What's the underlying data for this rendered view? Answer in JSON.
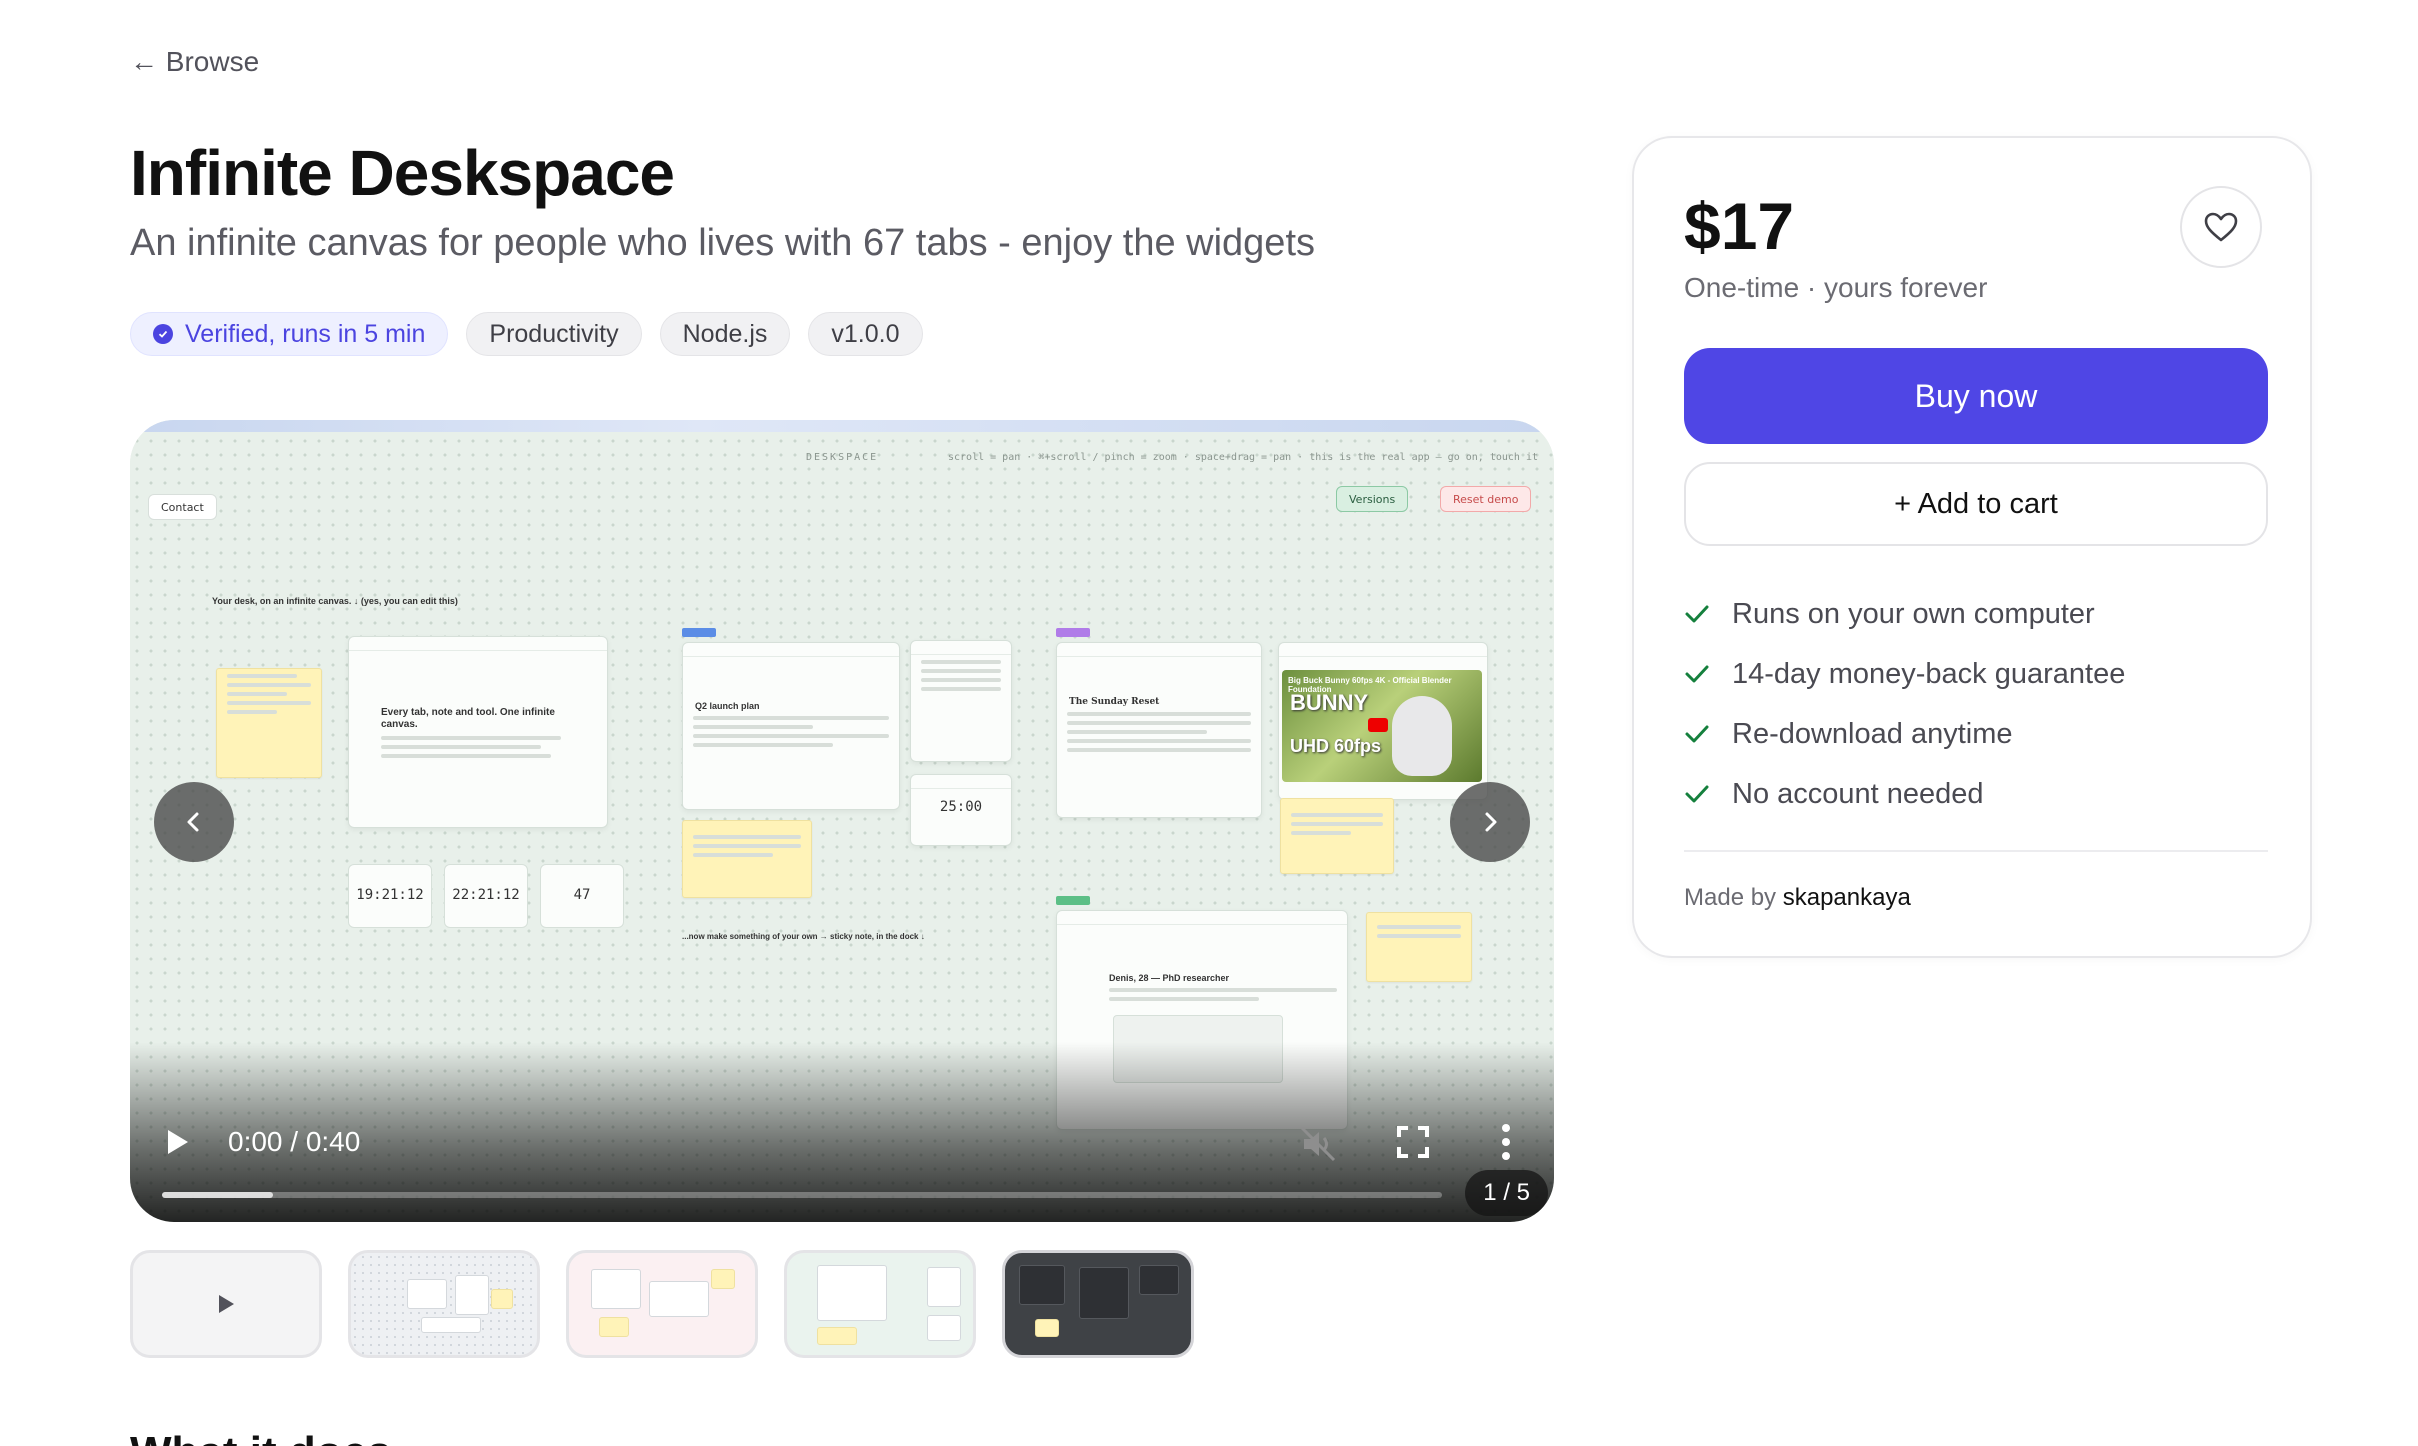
{
  "nav": {
    "back_label": "← Browse"
  },
  "product": {
    "title": "Infinite Deskspace",
    "subtitle": "An infinite canvas for people who lives with 67 tabs - enjoy the widgets",
    "tags": [
      {
        "label": "Verified, runs in 5 min",
        "icon": "verified-check-icon",
        "color": "#4b44e0"
      },
      {
        "label": "Productivity"
      },
      {
        "label": "Node.js"
      },
      {
        "label": "v1.0.0"
      }
    ]
  },
  "viewer": {
    "time": "0:00 / 0:40",
    "counter": "1 / 5",
    "progress_fraction": 0.087,
    "preview": {
      "brand": "DESKSPACE",
      "hint": "scroll = pan · ⌘+scroll / pinch = zoom · space+drag = pan · this is the real app — go on, touch it",
      "contact": "Contact",
      "versions": "Versions",
      "reset": "Reset demo",
      "intro": "Your desk, on an infinite canvas. ↓ (yes, you can edit this)",
      "card_heading": "Every tab, note and tool. One infinite canvas.",
      "q2": "Q2 launch plan",
      "sunday": "The Sunday Reset",
      "timer": "25:00",
      "clock1": "19:21:12",
      "clock2": "22:21:12",
      "count": "47",
      "cta": "...now make something of your own → sticky note, in the dock ↓",
      "profile": "Denis, 28 — PhD researcher",
      "video_title": "Big Buck Bunny 60fps 4K - Official Blender Foundation",
      "video_big": "BUNNY",
      "video_uhd": "UHD 60fps"
    }
  },
  "thumbnails": [
    "video",
    "canvas-light",
    "canvas-pink",
    "canvas-green",
    "canvas-dark"
  ],
  "section": {
    "heading": "What it does"
  },
  "purchase": {
    "price": "$17",
    "price_note": "One-time · yours forever",
    "buy_label": "Buy now",
    "cart_label": "+ Add to cart",
    "features": [
      "Runs on your own computer",
      "14-day money-back guarantee",
      "Re-download anytime",
      "No account needed"
    ],
    "made_by_prefix": "Made by",
    "maker": "skapankaya",
    "accent": "#4f46e5",
    "check_color": "#15803d"
  }
}
